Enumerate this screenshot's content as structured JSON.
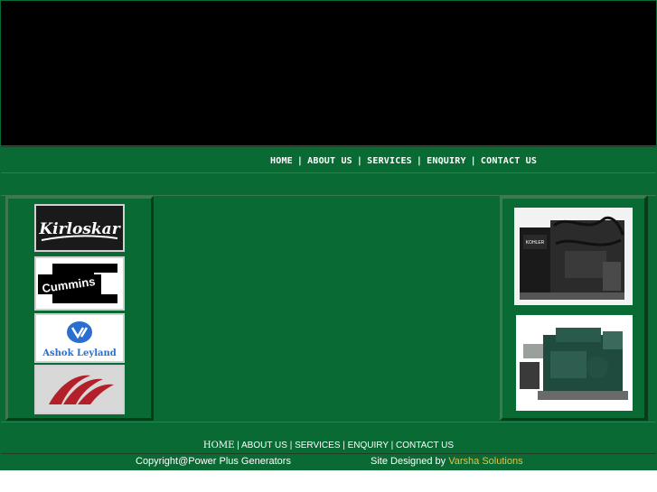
{
  "nav": {
    "items": [
      "HOME",
      "ABOUT US",
      "SERVICES",
      "ENQUIRY",
      "CONTACT US"
    ],
    "separator": "|"
  },
  "brands": [
    {
      "name": "Kirloskar",
      "icon": "kirloskar-logo"
    },
    {
      "name": "Cummins",
      "icon": "cummins-logo"
    },
    {
      "name": "Ashok Leyland",
      "icon": "ashok-leyland-logo"
    },
    {
      "name": "Mahindra",
      "icon": "mahindra-logo"
    }
  ],
  "photos": [
    {
      "icon": "generator-photo",
      "label": "KOHLER"
    },
    {
      "icon": "generator-set-photo"
    }
  ],
  "footer": {
    "nav": [
      "HOME",
      "ABOUT US",
      "SERVICES",
      "ENQUIRY",
      "CONTACT US"
    ],
    "copyright": "Copyright@Power Plus Generators",
    "designed_by": "Site Designed by",
    "designer": "Varsha Solutions"
  },
  "colors": {
    "page_green": "#0a6a33",
    "header_black": "#000000",
    "designer_link": "#e0c24a"
  }
}
